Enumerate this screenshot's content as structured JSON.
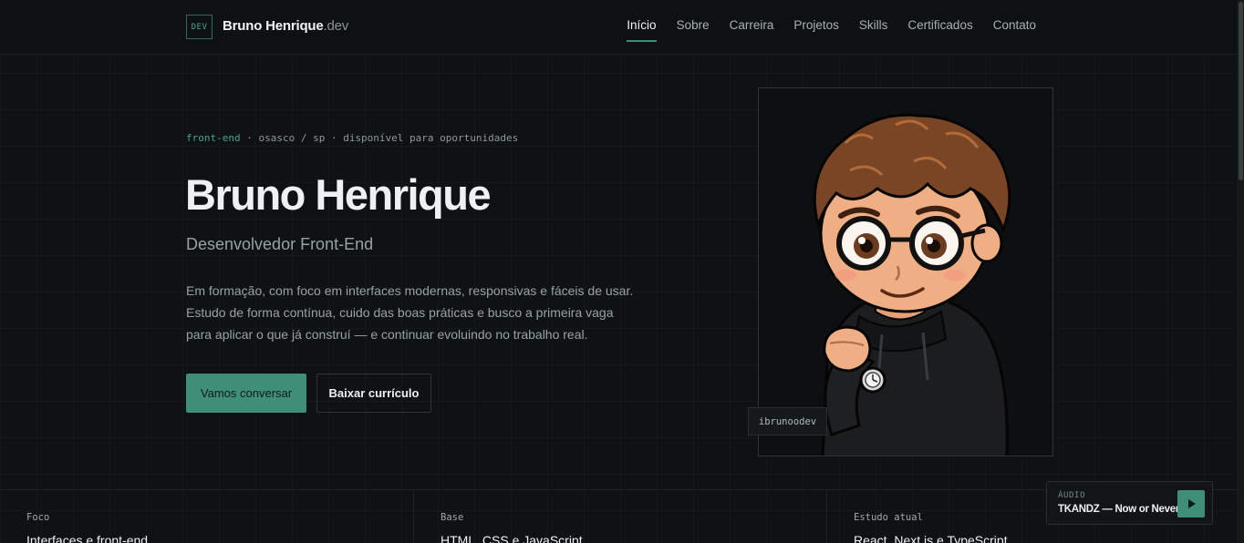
{
  "header": {
    "logo_badge": "DEV",
    "logo_name": "Bruno Henrique",
    "logo_suffix": ".dev",
    "nav": [
      {
        "label": "Início",
        "active": true
      },
      {
        "label": "Sobre",
        "active": false
      },
      {
        "label": "Carreira",
        "active": false
      },
      {
        "label": "Projetos",
        "active": false
      },
      {
        "label": "Skills",
        "active": false
      },
      {
        "label": "Certificados",
        "active": false
      },
      {
        "label": "Contato",
        "active": false
      }
    ]
  },
  "hero": {
    "eyebrow_accent": "front-end",
    "eyebrow_rest": " · osasco / sp · disponível para oportunidades",
    "title": "Bruno Henrique",
    "subtitle": "Desenvolvedor Front-End",
    "description": "Em formação, com foco em interfaces modernas, responsivas e fáceis de usar. Estudo de forma contínua, cuido das boas práticas e busco a primeira vaga para aplicar o que já construí — e continuar evoluindo no trabalho real.",
    "primary_button": "Vamos conversar",
    "secondary_button": "Baixar currículo"
  },
  "avatar": {
    "tag": "ibrunoodev"
  },
  "stats": [
    {
      "label": "Foco",
      "value": "Interfaces e front-end"
    },
    {
      "label": "Base",
      "value": "HTML, CSS e JavaScript"
    },
    {
      "label": "Estudo atual",
      "value": "React, Next.js e TypeScript"
    }
  ],
  "audio": {
    "label": "ÁUDIO",
    "track": "TKANDZ — Now or Never",
    "play_icon": "play-icon"
  },
  "colors": {
    "accent": "#3e8f76",
    "background": "#0f1214",
    "text": "#eef0f1",
    "muted": "#9aa1a5"
  }
}
